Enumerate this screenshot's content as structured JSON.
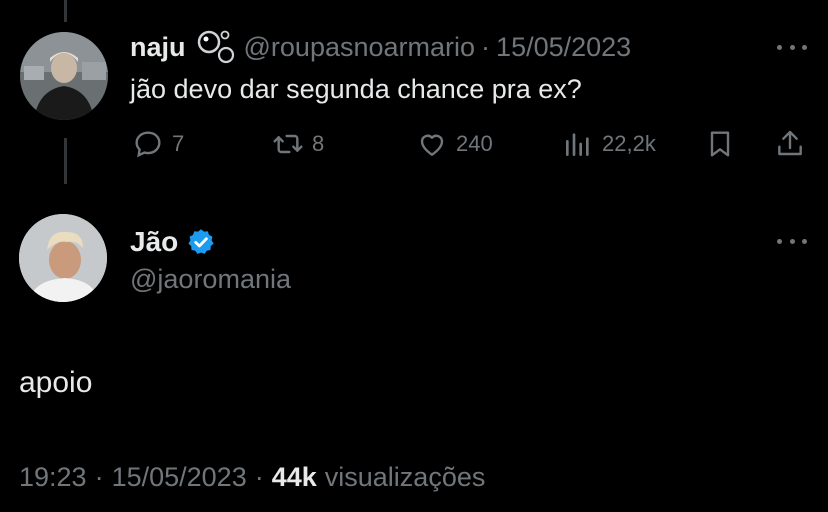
{
  "reply_tweet": {
    "name": "naju",
    "name_emoji": "bubbles-icon",
    "handle": "@roupasnoarmario",
    "separator": "·",
    "date": "15/05/2023",
    "text": "jão devo dar segunda chance pra ex?",
    "actions": {
      "replies": "7",
      "retweets": "8",
      "likes": "240",
      "views": "22,2k"
    }
  },
  "main_tweet": {
    "name": "Jão",
    "handle": "@jaoromania",
    "text": "apoio",
    "time": "19:23",
    "separator1": "·",
    "date": "15/05/2023",
    "separator2": "·",
    "views_count": "44k",
    "views_label": "visualizações"
  },
  "colors": {
    "background": "#000000",
    "primary_text": "#e7e9ea",
    "secondary_text": "#71767b",
    "verified_blue": "#1d9bf0"
  }
}
